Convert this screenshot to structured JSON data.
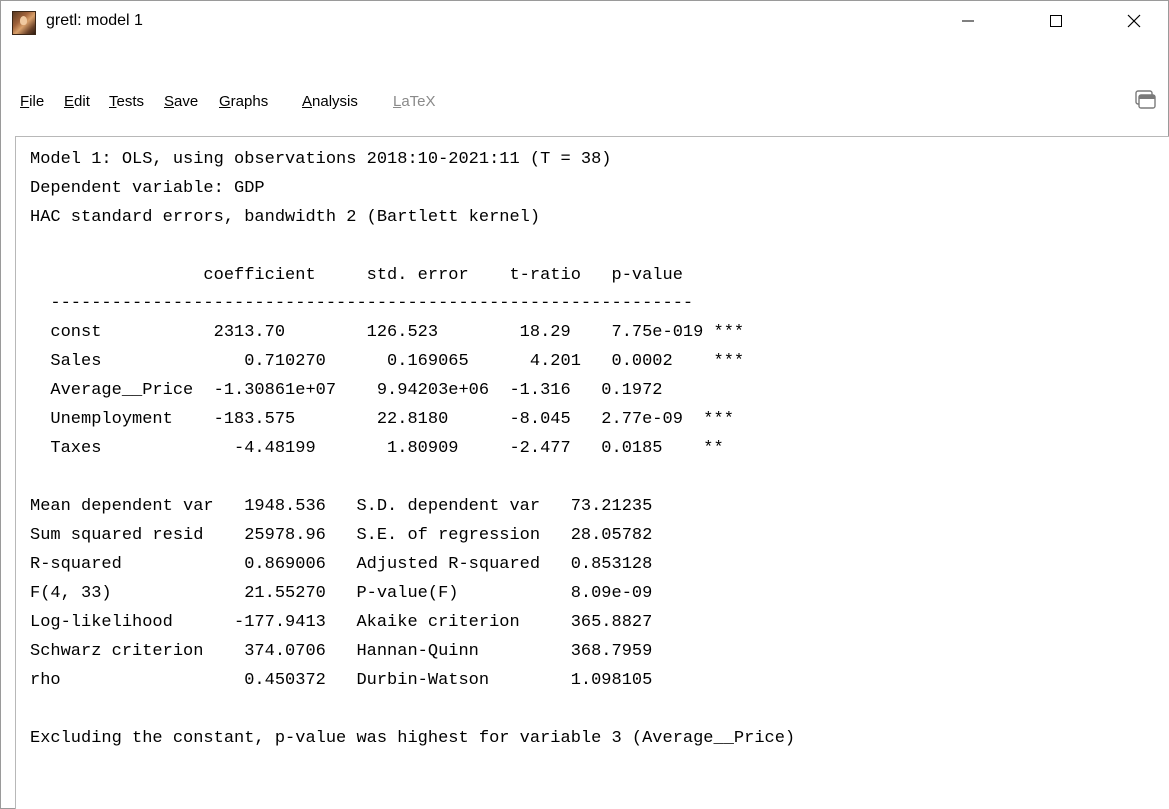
{
  "window": {
    "title": "gretl: model 1"
  },
  "menu": {
    "file": "File",
    "edit": "Edit",
    "tests": "Tests",
    "save": "Save",
    "graphs": "Graphs",
    "analysis": "Analysis",
    "latex": "LaTeX"
  },
  "icons": {
    "app": "gretl-app-icon",
    "minimize": "minimize-icon",
    "maximize": "maximize-icon",
    "close": "close-icon",
    "corner": "window-stack-icon"
  },
  "output": {
    "header_line1": "Model 1: OLS, using observations 2018:10-2021:11 (T = 38)",
    "header_line2": "Dependent variable: GDP",
    "header_line3": "HAC standard errors, bandwidth 2 (Bartlett kernel)",
    "table_header": "                 coefficient     std. error    t-ratio   p-value",
    "table_rule": "  ---------------------------------------------------------------",
    "rows": [
      "  const           2313.70        126.523        18.29    7.75e-019 ***",
      "  Sales              0.710270      0.169065      4.201   0.0002    ***",
      "  Average__Price  -1.30861e+07    9.94203e+06  -1.316   0.1972",
      "  Unemployment    -183.575        22.8180      -8.045   2.77e-09  ***",
      "  Taxes             -4.48199       1.80909     -2.477   0.0185    **"
    ],
    "stats": [
      "Mean dependent var   1948.536   S.D. dependent var   73.21235",
      "Sum squared resid    25978.96   S.E. of regression   28.05782",
      "R-squared            0.869006   Adjusted R-squared   0.853128",
      "F(4, 33)             21.55270   P-value(F)           8.09e-09",
      "Log-likelihood      -177.9413   Akaike criterion     365.8827",
      "Schwarz criterion    374.0706   Hannan-Quinn         368.7959",
      "rho                  0.450372   Durbin-Watson        1.098105"
    ],
    "footer": "Excluding the constant, p-value was highest for variable 3 (Average__Price)"
  }
}
